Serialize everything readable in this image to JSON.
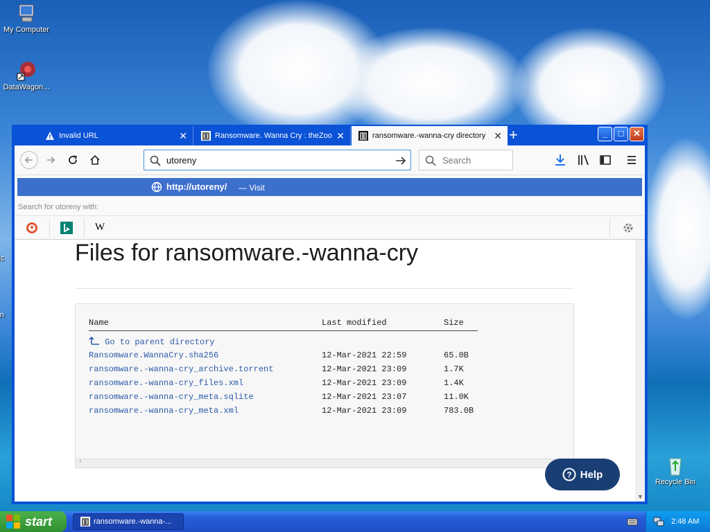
{
  "desktop": {
    "icons": [
      {
        "label": "My Computer"
      },
      {
        "label": "DataWagon..."
      },
      {
        "label": "Recycle Bin"
      }
    ],
    "partial_labels": [
      "Mic",
      "Mic",
      "ran"
    ]
  },
  "browser": {
    "tabs": [
      {
        "title": "Invalid URL"
      },
      {
        "title": "Ransomware. Wanna Cry : theZoo"
      },
      {
        "title": "ransomware.-wanna-cry directory"
      }
    ],
    "new_tab": "+",
    "address_value": "utoreny",
    "search_placeholder": "Search",
    "suggestion_url": "http://utoreny/",
    "suggestion_action": "— Visit",
    "search_for_text": "Search for utoreny with:"
  },
  "page": {
    "title": "Files for ransomware.-wanna-cry",
    "columns": [
      "Name",
      "Last modified",
      "Size"
    ],
    "parent_link": "Go to parent directory",
    "files": [
      {
        "name": "Ransomware.WannaCry.sha256",
        "modified": "12-Mar-2021 22:59",
        "size": "65.0B"
      },
      {
        "name": "ransomware.-wanna-cry_archive.torrent",
        "modified": "12-Mar-2021 23:09",
        "size": "1.7K"
      },
      {
        "name": "ransomware.-wanna-cry_files.xml",
        "modified": "12-Mar-2021 23:09",
        "size": "1.4K"
      },
      {
        "name": "ransomware.-wanna-cry_meta.sqlite",
        "modified": "12-Mar-2021 23:07",
        "size": "11.0K"
      },
      {
        "name": "ransomware.-wanna-cry_meta.xml",
        "modified": "12-Mar-2021 23:09",
        "size": "783.0B"
      }
    ],
    "help_label": "Help"
  },
  "taskbar": {
    "start_label": "start",
    "task_label": "ransomware.-wanna-...",
    "clock": "2:48 AM"
  },
  "colors": {
    "accent": "#3d6fcd",
    "link": "#2c5aa8",
    "help_bg": "#193e74"
  }
}
